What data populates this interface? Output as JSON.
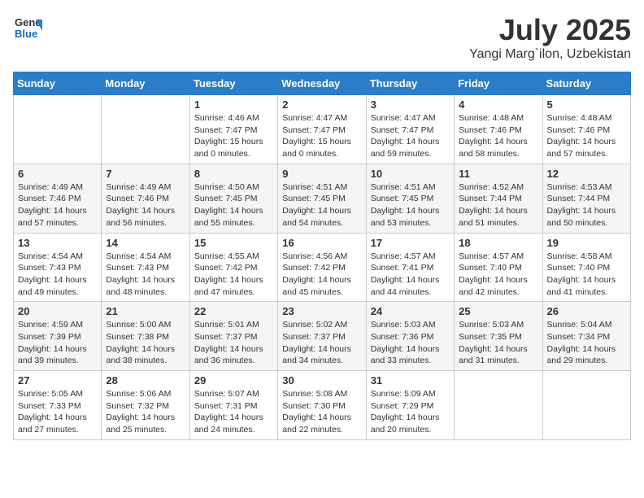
{
  "header": {
    "logo_line1": "General",
    "logo_line2": "Blue",
    "month": "July 2025",
    "location": "Yangi Marg`ilon, Uzbekistan"
  },
  "weekdays": [
    "Sunday",
    "Monday",
    "Tuesday",
    "Wednesday",
    "Thursday",
    "Friday",
    "Saturday"
  ],
  "weeks": [
    [
      {
        "day": "",
        "content": ""
      },
      {
        "day": "",
        "content": ""
      },
      {
        "day": "1",
        "content": "Sunrise: 4:46 AM\nSunset: 7:47 PM\nDaylight: 15 hours\nand 0 minutes."
      },
      {
        "day": "2",
        "content": "Sunrise: 4:47 AM\nSunset: 7:47 PM\nDaylight: 15 hours\nand 0 minutes."
      },
      {
        "day": "3",
        "content": "Sunrise: 4:47 AM\nSunset: 7:47 PM\nDaylight: 14 hours\nand 59 minutes."
      },
      {
        "day": "4",
        "content": "Sunrise: 4:48 AM\nSunset: 7:46 PM\nDaylight: 14 hours\nand 58 minutes."
      },
      {
        "day": "5",
        "content": "Sunrise: 4:48 AM\nSunset: 7:46 PM\nDaylight: 14 hours\nand 57 minutes."
      }
    ],
    [
      {
        "day": "6",
        "content": "Sunrise: 4:49 AM\nSunset: 7:46 PM\nDaylight: 14 hours\nand 57 minutes."
      },
      {
        "day": "7",
        "content": "Sunrise: 4:49 AM\nSunset: 7:46 PM\nDaylight: 14 hours\nand 56 minutes."
      },
      {
        "day": "8",
        "content": "Sunrise: 4:50 AM\nSunset: 7:45 PM\nDaylight: 14 hours\nand 55 minutes."
      },
      {
        "day": "9",
        "content": "Sunrise: 4:51 AM\nSunset: 7:45 PM\nDaylight: 14 hours\nand 54 minutes."
      },
      {
        "day": "10",
        "content": "Sunrise: 4:51 AM\nSunset: 7:45 PM\nDaylight: 14 hours\nand 53 minutes."
      },
      {
        "day": "11",
        "content": "Sunrise: 4:52 AM\nSunset: 7:44 PM\nDaylight: 14 hours\nand 51 minutes."
      },
      {
        "day": "12",
        "content": "Sunrise: 4:53 AM\nSunset: 7:44 PM\nDaylight: 14 hours\nand 50 minutes."
      }
    ],
    [
      {
        "day": "13",
        "content": "Sunrise: 4:54 AM\nSunset: 7:43 PM\nDaylight: 14 hours\nand 49 minutes."
      },
      {
        "day": "14",
        "content": "Sunrise: 4:54 AM\nSunset: 7:43 PM\nDaylight: 14 hours\nand 48 minutes."
      },
      {
        "day": "15",
        "content": "Sunrise: 4:55 AM\nSunset: 7:42 PM\nDaylight: 14 hours\nand 47 minutes."
      },
      {
        "day": "16",
        "content": "Sunrise: 4:56 AM\nSunset: 7:42 PM\nDaylight: 14 hours\nand 45 minutes."
      },
      {
        "day": "17",
        "content": "Sunrise: 4:57 AM\nSunset: 7:41 PM\nDaylight: 14 hours\nand 44 minutes."
      },
      {
        "day": "18",
        "content": "Sunrise: 4:57 AM\nSunset: 7:40 PM\nDaylight: 14 hours\nand 42 minutes."
      },
      {
        "day": "19",
        "content": "Sunrise: 4:58 AM\nSunset: 7:40 PM\nDaylight: 14 hours\nand 41 minutes."
      }
    ],
    [
      {
        "day": "20",
        "content": "Sunrise: 4:59 AM\nSunset: 7:39 PM\nDaylight: 14 hours\nand 39 minutes."
      },
      {
        "day": "21",
        "content": "Sunrise: 5:00 AM\nSunset: 7:38 PM\nDaylight: 14 hours\nand 38 minutes."
      },
      {
        "day": "22",
        "content": "Sunrise: 5:01 AM\nSunset: 7:37 PM\nDaylight: 14 hours\nand 36 minutes."
      },
      {
        "day": "23",
        "content": "Sunrise: 5:02 AM\nSunset: 7:37 PM\nDaylight: 14 hours\nand 34 minutes."
      },
      {
        "day": "24",
        "content": "Sunrise: 5:03 AM\nSunset: 7:36 PM\nDaylight: 14 hours\nand 33 minutes."
      },
      {
        "day": "25",
        "content": "Sunrise: 5:03 AM\nSunset: 7:35 PM\nDaylight: 14 hours\nand 31 minutes."
      },
      {
        "day": "26",
        "content": "Sunrise: 5:04 AM\nSunset: 7:34 PM\nDaylight: 14 hours\nand 29 minutes."
      }
    ],
    [
      {
        "day": "27",
        "content": "Sunrise: 5:05 AM\nSunset: 7:33 PM\nDaylight: 14 hours\nand 27 minutes."
      },
      {
        "day": "28",
        "content": "Sunrise: 5:06 AM\nSunset: 7:32 PM\nDaylight: 14 hours\nand 25 minutes."
      },
      {
        "day": "29",
        "content": "Sunrise: 5:07 AM\nSunset: 7:31 PM\nDaylight: 14 hours\nand 24 minutes."
      },
      {
        "day": "30",
        "content": "Sunrise: 5:08 AM\nSunset: 7:30 PM\nDaylight: 14 hours\nand 22 minutes."
      },
      {
        "day": "31",
        "content": "Sunrise: 5:09 AM\nSunset: 7:29 PM\nDaylight: 14 hours\nand 20 minutes."
      },
      {
        "day": "",
        "content": ""
      },
      {
        "day": "",
        "content": ""
      }
    ]
  ]
}
